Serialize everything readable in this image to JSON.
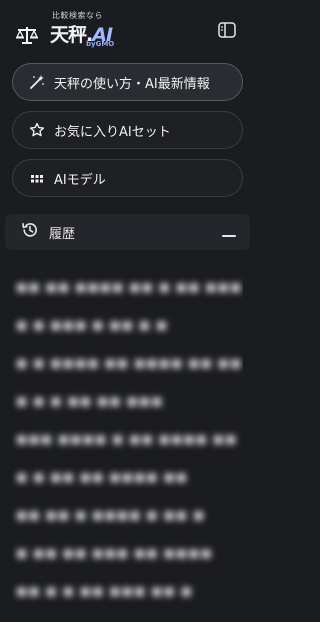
{
  "header": {
    "logo_tagline": "比較検索なら",
    "logo_main": "天秤",
    "logo_dot": ".",
    "logo_ai": "AI",
    "logo_sub": "byGMO",
    "logo_icon": "scale-icon",
    "toggle_icon": "sidebar-toggle-icon"
  },
  "nav": {
    "items": [
      {
        "label": "天秤の使い方・AI最新情報",
        "icon": "magic-wand-icon",
        "active": true
      },
      {
        "label": "お気に入りAIセット",
        "icon": "star-icon",
        "active": false
      },
      {
        "label": "AIモデル",
        "icon": "grid-dots-icon",
        "active": false
      }
    ]
  },
  "history": {
    "title": "履歴",
    "icon": "history-clock-icon",
    "collapse_icon": "minus-icon",
    "items": [
      "■■ ■■ ■■■■ ■■ ■ ■■ ■■■",
      "■ ■ ■■■ ■ ■■ ■ ■",
      "■ ■ ■■■■ ■■ ■■■■ ■■ ■■",
      "■ ■ ■ ■■ ■■ ■■■",
      "■■■ ■■■■ ■ ■■ ■■■■ ■■",
      "■ ■ ■■ ■■ ■■■■ ■■",
      "■■ ■■ ■ ■■■■ ■ ■■ ■",
      "■ ■■ ■■ ■■■ ■■ ■■■■",
      "■■ ■ ■ ■■ ■■■ ■■ ■"
    ]
  },
  "colors": {
    "background": "#1b1c1f",
    "accent": "#9fb8ff",
    "border": "#3a3c42"
  }
}
